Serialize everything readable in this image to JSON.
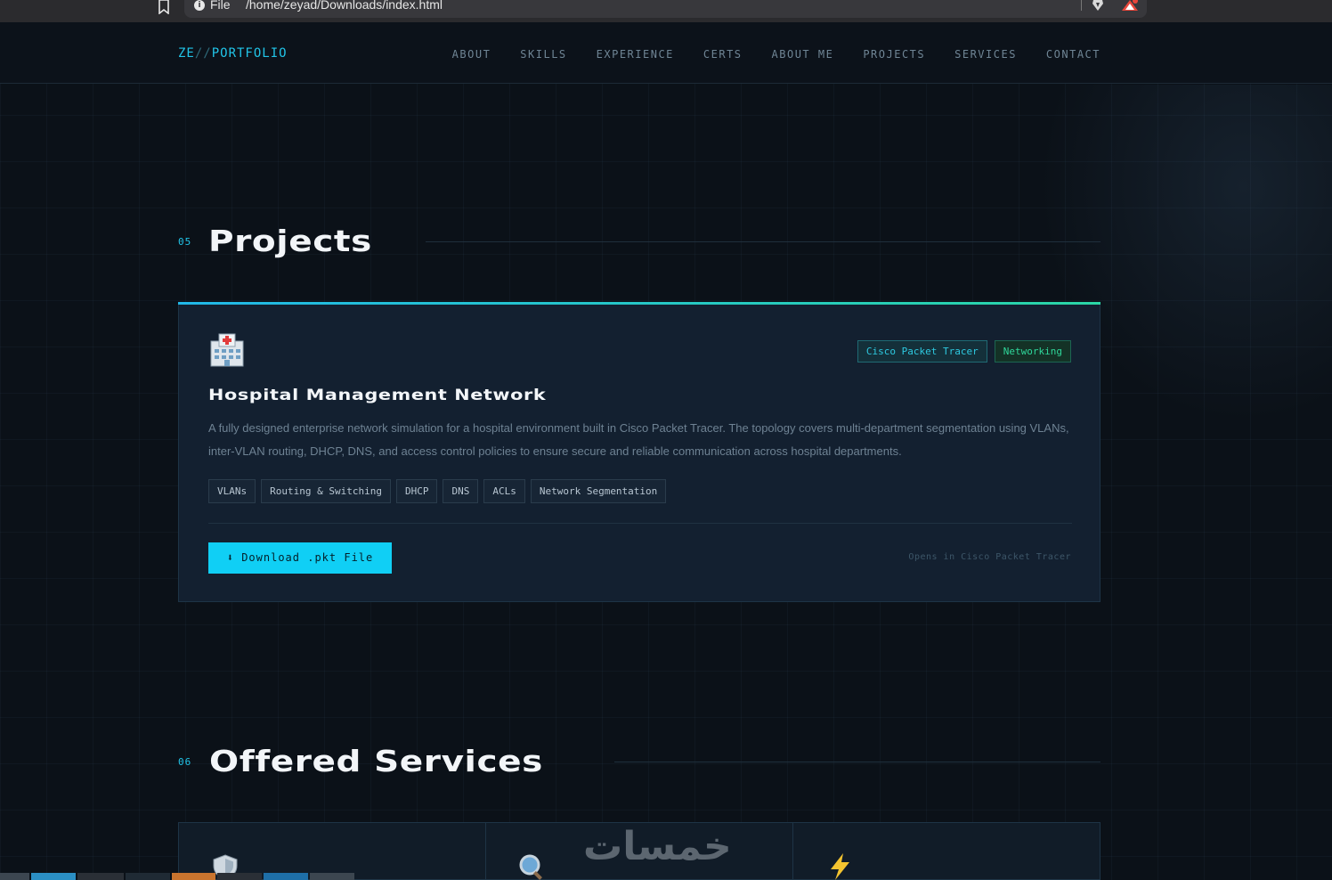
{
  "browser": {
    "url_scheme": "File",
    "url": "/home/zeyad/Downloads/index.html",
    "icons": [
      "bookmark-icon",
      "info-icon",
      "brave-shield-icon",
      "brave-rewards-icon"
    ]
  },
  "nav": {
    "logo_prefix": "ZE",
    "logo_slash": "//",
    "logo_name": "PORTFOLIO",
    "links": [
      "ABOUT",
      "SKILLS",
      "EXPERIENCE",
      "CERTS",
      "ABOUT ME",
      "PROJECTS",
      "SERVICES",
      "CONTACT"
    ]
  },
  "projects_section": {
    "number": "05",
    "title": "Projects"
  },
  "project": {
    "icon": "hospital-icon",
    "category_tags": [
      "Cisco Packet Tracer",
      "Networking"
    ],
    "title": "Hospital Management Network",
    "description": "A fully designed enterprise network simulation for a hospital environment built in Cisco Packet Tracer. The topology covers multi-department segmentation using VLANs, inter-VLAN routing, DHCP, DNS, and access control policies to ensure secure and reliable communication across hospital departments.",
    "tech_tags": [
      "VLANs",
      "Routing & Switching",
      "DHCP",
      "DNS",
      "ACLs",
      "Network Segmentation"
    ],
    "download_label": "⬇ Download .pkt File",
    "opens_note": "Opens in Cisco Packet Tracer"
  },
  "services_section": {
    "number": "06",
    "title": "Offered Services",
    "cards": [
      {
        "icon": "shield-icon"
      },
      {
        "icon": "magnifier-icon"
      },
      {
        "icon": "lightning-icon"
      }
    ]
  },
  "watermark": "خمسات",
  "colors": {
    "accent": "#21c4e8",
    "accent_green": "#2fd79a",
    "background": "#0b1118",
    "card": "#132030"
  }
}
